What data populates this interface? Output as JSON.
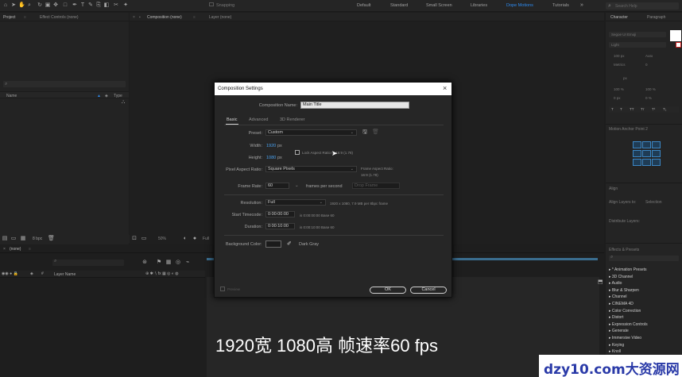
{
  "toolbar": {
    "snapping_label": "Snapping",
    "workspaces": [
      "Default",
      "Standard",
      "Small Screen",
      "Libraries",
      "Dope Motions",
      "Tutorials"
    ],
    "active_workspace": "Dope Motions",
    "search_placeholder": "Search Help"
  },
  "project_panel": {
    "tabs": [
      "Project",
      "Effect Controls (none)"
    ],
    "columns": {
      "name": "Name",
      "type": "Type"
    },
    "footer_bpc": "8 bpc"
  },
  "comp_panel": {
    "tabs": [
      "Composition (none)",
      "Layer (none)"
    ],
    "zoom": "50%",
    "resolution": "Full"
  },
  "character_panel": {
    "tabs": [
      "Character",
      "Paragraph"
    ],
    "font_family": "Segoe UI Emoji",
    "font_style": "Light",
    "font_size": "100 px",
    "kerning": "Metrics",
    "tracking": "0",
    "leading": "Auto",
    "stroke": "px",
    "indent_vertical": "100 %",
    "indent_horizontal": "100 %",
    "baseline": "0 px",
    "tsume": "0 %"
  },
  "anchor_panel": {
    "title": "Motion Anchor Point 2"
  },
  "align_panel": {
    "title": "Align",
    "align_to_label": "Align Layers to:",
    "align_to_value": "Selection",
    "distribute_label": "Distribute Layers:"
  },
  "effects_panel": {
    "title": "Effects & Presets",
    "search_placeholder": "",
    "items": [
      "* Animation Presets",
      "3D Channel",
      "Audio",
      "Blur & Sharpen",
      "Channel",
      "CINEMA 4D",
      "Color Correction",
      "Distort",
      "Expression Controls",
      "Generate",
      "Immersive Video",
      "Keying",
      "Knoll"
    ]
  },
  "timeline": {
    "tab": "(none)",
    "layer_name_col": "Layer Name"
  },
  "dialog": {
    "title": "Composition Settings",
    "comp_name_label": "Composition Name:",
    "comp_name_value": "Main Title",
    "tabs": [
      "Basic",
      "Advanced",
      "3D Renderer"
    ],
    "preset_label": "Preset:",
    "preset_value": "Custom",
    "width_label": "Width:",
    "width_value": "1920",
    "height_label": "Height:",
    "height_value": "1080",
    "unit_px": "px",
    "lock_label": "Lock Aspect Ratio to 16:9 (1.78)",
    "pixel_aspect_label": "Pixel Aspect Ratio:",
    "pixel_aspect_value": "Square Pixels",
    "frame_aspect_label": "Frame Aspect Ratio:",
    "frame_aspect_value": "16:9 (1.78)",
    "frame_rate_label": "Frame Rate:",
    "frame_rate_value": "60",
    "frames_per_second": "frames per second",
    "drop_frame_value": "Drop Frame",
    "resolution_label": "Resolution:",
    "resolution_value": "Full",
    "resolution_note": "1920 x 1080, 7.9 MB per 8bpc frame",
    "start_timecode_label": "Start Timecode:",
    "start_timecode_value": "0:00:00:00",
    "start_timecode_note": "is 0:00:00:00  Base 60",
    "duration_label": "Duration:",
    "duration_value": "0:00:10:00",
    "duration_note": "is 0:00:10:00  Base 60",
    "bg_color_label": "Background Color:",
    "bg_color_name": "Dark Gray",
    "preview_label": "Preview",
    "ok_label": "OK",
    "cancel_label": "Cancel"
  },
  "caption": "1920宽 1080高 帧速率60 fps",
  "watermark": "dzy10.com大资源网",
  "colors": {
    "accent": "#2e8bf0",
    "value_blue": "#4aa2f0",
    "dialog_bg": "#262626",
    "panel_bg": "#232323"
  }
}
